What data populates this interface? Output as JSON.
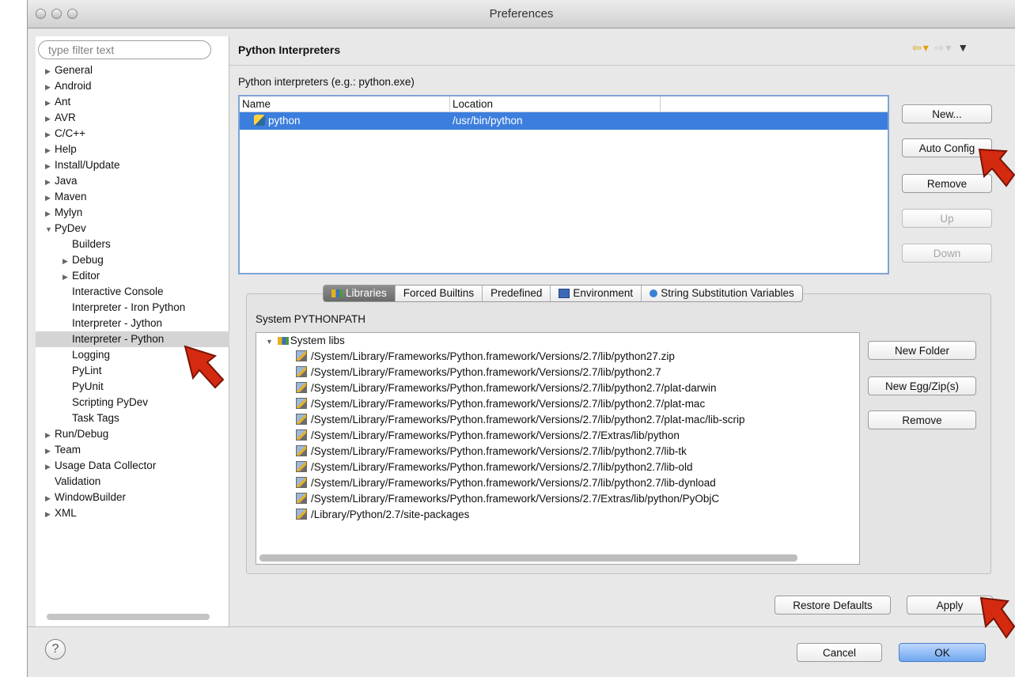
{
  "window": {
    "title": "Preferences"
  },
  "sidebar": {
    "filter_placeholder": "type filter text",
    "items": [
      {
        "label": "General",
        "expander": "▶",
        "indent": 0
      },
      {
        "label": "Android",
        "expander": "▶",
        "indent": 0
      },
      {
        "label": "Ant",
        "expander": "▶",
        "indent": 0
      },
      {
        "label": "AVR",
        "expander": "▶",
        "indent": 0
      },
      {
        "label": "C/C++",
        "expander": "▶",
        "indent": 0
      },
      {
        "label": "Help",
        "expander": "▶",
        "indent": 0
      },
      {
        "label": "Install/Update",
        "expander": "▶",
        "indent": 0
      },
      {
        "label": "Java",
        "expander": "▶",
        "indent": 0
      },
      {
        "label": "Maven",
        "expander": "▶",
        "indent": 0
      },
      {
        "label": "Mylyn",
        "expander": "▶",
        "indent": 0
      },
      {
        "label": "PyDev",
        "expander": "▼",
        "indent": 0
      },
      {
        "label": "Builders",
        "expander": "",
        "indent": 1
      },
      {
        "label": "Debug",
        "expander": "▶",
        "indent": 1
      },
      {
        "label": "Editor",
        "expander": "▶",
        "indent": 1
      },
      {
        "label": "Interactive Console",
        "expander": "",
        "indent": 1
      },
      {
        "label": "Interpreter - Iron Python",
        "expander": "",
        "indent": 1
      },
      {
        "label": "Interpreter - Jython",
        "expander": "",
        "indent": 1
      },
      {
        "label": "Interpreter - Python",
        "expander": "",
        "indent": 1,
        "selected": true
      },
      {
        "label": "Logging",
        "expander": "",
        "indent": 1
      },
      {
        "label": "PyLint",
        "expander": "",
        "indent": 1
      },
      {
        "label": "PyUnit",
        "expander": "",
        "indent": 1
      },
      {
        "label": "Scripting PyDev",
        "expander": "",
        "indent": 1
      },
      {
        "label": "Task Tags",
        "expander": "",
        "indent": 1
      },
      {
        "label": "Run/Debug",
        "expander": "▶",
        "indent": 0
      },
      {
        "label": "Team",
        "expander": "▶",
        "indent": 0
      },
      {
        "label": "Usage Data Collector",
        "expander": "▶",
        "indent": 0
      },
      {
        "label": "Validation",
        "expander": "",
        "indent": 0
      },
      {
        "label": "WindowBuilder",
        "expander": "▶",
        "indent": 0
      },
      {
        "label": "XML",
        "expander": "▶",
        "indent": 0
      }
    ]
  },
  "page": {
    "title": "Python Interpreters",
    "interpreters_label": "Python interpreters (e.g.: python.exe)",
    "table": {
      "columns": [
        "Name",
        "Location"
      ],
      "rows": [
        {
          "name": "python",
          "location": "/usr/bin/python"
        }
      ]
    },
    "buttons": {
      "new": "New...",
      "auto_config": "Auto Config",
      "remove": "Remove",
      "up": "Up",
      "down": "Down"
    },
    "tabs": [
      "Libraries",
      "Forced Builtins",
      "Predefined",
      "Environment",
      "String Substitution Variables"
    ],
    "pythonpath_label": "System PYTHONPATH",
    "system_libs_label": "System libs",
    "libs": [
      "/System/Library/Frameworks/Python.framework/Versions/2.7/lib/python27.zip",
      "/System/Library/Frameworks/Python.framework/Versions/2.7/lib/python2.7",
      "/System/Library/Frameworks/Python.framework/Versions/2.7/lib/python2.7/plat-darwin",
      "/System/Library/Frameworks/Python.framework/Versions/2.7/lib/python2.7/plat-mac",
      "/System/Library/Frameworks/Python.framework/Versions/2.7/lib/python2.7/plat-mac/lib-scrip",
      "/System/Library/Frameworks/Python.framework/Versions/2.7/Extras/lib/python",
      "/System/Library/Frameworks/Python.framework/Versions/2.7/lib/python2.7/lib-tk",
      "/System/Library/Frameworks/Python.framework/Versions/2.7/lib/python2.7/lib-old",
      "/System/Library/Frameworks/Python.framework/Versions/2.7/lib/python2.7/lib-dynload",
      "/System/Library/Frameworks/Python.framework/Versions/2.7/Extras/lib/python/PyObjC",
      "/Library/Python/2.7/site-packages"
    ],
    "lib_buttons": {
      "new_folder": "New Folder",
      "new_egg": "New Egg/Zip(s)",
      "remove": "Remove"
    },
    "restore_defaults": "Restore Defaults",
    "apply": "Apply"
  },
  "footer": {
    "help": "?",
    "cancel": "Cancel",
    "ok": "OK"
  },
  "colors": {
    "selection": "#3c7ede",
    "annotation_arrow": "#d42a10",
    "back_arrow": "#e0a000"
  }
}
